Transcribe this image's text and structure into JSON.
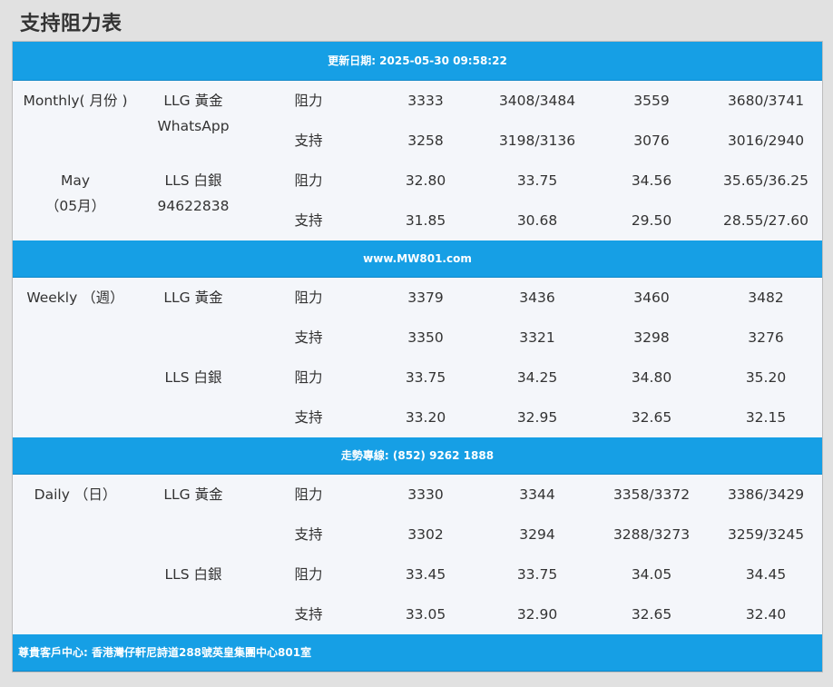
{
  "page": {
    "title": "支持阻力表"
  },
  "bands": {
    "update": "更新日期: 2025-05-30 09:58:22",
    "website": "www.MW801.com",
    "hotline": "走勢專線: (852) 9262 1888",
    "footer": "尊貴客戶中心: 香港灣仔軒尼詩道288號英皇集團中心801室"
  },
  "labels": {
    "resistance": "阻力",
    "support": "支持"
  },
  "monthly": {
    "period_line1": "Monthly( 月份 )",
    "period_line2": "May",
    "period_line3": "（05月）",
    "gold_label": "LLG 黃金",
    "whatsapp_label": "WhatsApp",
    "silver_label": "LLS 白銀",
    "phone": "94622838",
    "gold": {
      "resistance": [
        "3333",
        "3408/3484",
        "3559",
        "3680/3741"
      ],
      "support": [
        "3258",
        "3198/3136",
        "3076",
        "3016/2940"
      ]
    },
    "silver": {
      "resistance": [
        "32.80",
        "33.75",
        "34.56",
        "35.65/36.25"
      ],
      "support": [
        "31.85",
        "30.68",
        "29.50",
        "28.55/27.60"
      ]
    }
  },
  "weekly": {
    "period_line1": "Weekly （週）",
    "gold_label": "LLG 黃金",
    "silver_label": "LLS 白銀",
    "gold": {
      "resistance": [
        "3379",
        "3436",
        "3460",
        "3482"
      ],
      "support": [
        "3350",
        "3321",
        "3298",
        "3276"
      ]
    },
    "silver": {
      "resistance": [
        "33.75",
        "34.25",
        "34.80",
        "35.20"
      ],
      "support": [
        "33.20",
        "32.95",
        "32.65",
        "32.15"
      ]
    }
  },
  "daily": {
    "period_line1": "Daily （日）",
    "gold_label": "LLG 黃金",
    "silver_label": "LLS 白銀",
    "gold": {
      "resistance": [
        "3330",
        "3344",
        "3358/3372",
        "3386/3429"
      ],
      "support": [
        "3302",
        "3294",
        "3288/3273",
        "3259/3245"
      ]
    },
    "silver": {
      "resistance": [
        "33.45",
        "33.75",
        "34.05",
        "34.45"
      ],
      "support": [
        "33.05",
        "32.90",
        "32.65",
        "32.40"
      ]
    }
  }
}
